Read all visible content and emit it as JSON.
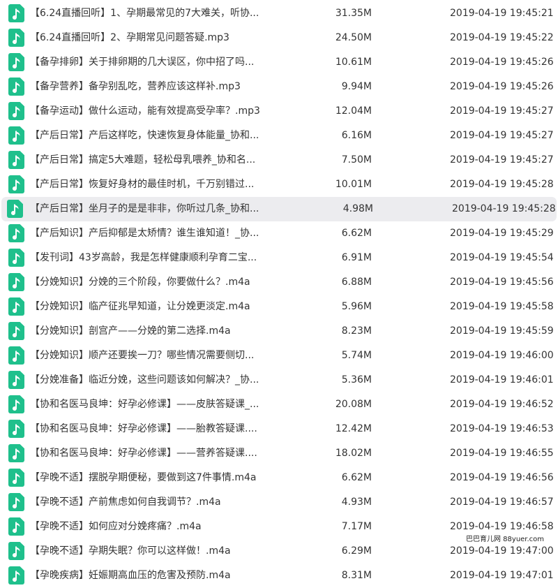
{
  "files": [
    {
      "name": "【6.24直播回听】1、孕期最常见的7大难关，听协...",
      "size": "31.35M",
      "date": "2019-04-19 19:45:21"
    },
    {
      "name": "【6.24直播回听】2、孕期常见问题答疑.mp3",
      "size": "24.50M",
      "date": "2019-04-19 19:45:22"
    },
    {
      "name": "【备孕排卵】关于排卵期的几大误区，你中招了吗...",
      "size": "10.61M",
      "date": "2019-04-19 19:45:26"
    },
    {
      "name": "【备孕营养】备孕别乱吃，营养应该这样补.mp3",
      "size": "9.94M",
      "date": "2019-04-19 19:45:26"
    },
    {
      "name": "【备孕运动】做什么运动，能有效提高受孕率？.mp3",
      "size": "12.04M",
      "date": "2019-04-19 19:45:27"
    },
    {
      "name": "【产后日常】产后这样吃，快速恢复身体能量_协和...",
      "size": "6.16M",
      "date": "2019-04-19 19:45:27"
    },
    {
      "name": "【产后日常】搞定5大难题，轻松母乳喂养_协和名...",
      "size": "7.50M",
      "date": "2019-04-19 19:45:27"
    },
    {
      "name": "【产后日常】恢复好身材的最佳时机，千万别错过...",
      "size": "10.01M",
      "date": "2019-04-19 19:45:28"
    },
    {
      "name": "【产后日常】坐月子的是是非非，你听过几条_协和...",
      "size": "4.98M",
      "date": "2019-04-19 19:45:28",
      "selected": true
    },
    {
      "name": "【产后知识】产后抑郁是太矫情？谁生谁知道！_协...",
      "size": "6.62M",
      "date": "2019-04-19 19:45:29"
    },
    {
      "name": "【发刊词】43岁高龄，我是怎样健康顺利孕育二宝...",
      "size": "6.91M",
      "date": "2019-04-19 19:45:54"
    },
    {
      "name": "【分娩知识】分娩的三个阶段，你要做什么？.m4a",
      "size": "6.88M",
      "date": "2019-04-19 19:45:56"
    },
    {
      "name": "【分娩知识】临产征兆早知道，让分娩更淡定.m4a",
      "size": "5.96M",
      "date": "2019-04-19 19:45:58"
    },
    {
      "name": "【分娩知识】剖宫产——分娩的第二选择.m4a",
      "size": "8.23M",
      "date": "2019-04-19 19:45:59"
    },
    {
      "name": "【分娩知识】顺产还要挨一刀？哪些情况需要侧切...",
      "size": "5.74M",
      "date": "2019-04-19 19:46:00"
    },
    {
      "name": "【分娩准备】临近分娩，这些问题该如何解决？_协...",
      "size": "5.36M",
      "date": "2019-04-19 19:46:01"
    },
    {
      "name": "【协和名医马良坤：好孕必修课】——皮肤答疑课_...",
      "size": "20.08M",
      "date": "2019-04-19 19:46:52"
    },
    {
      "name": "【协和名医马良坤：好孕必修课】——胎教答疑课....",
      "size": "12.42M",
      "date": "2019-04-19 19:46:53"
    },
    {
      "name": "【协和名医马良坤：好孕必修课】——营养答疑课....",
      "size": "18.02M",
      "date": "2019-04-19 19:46:55"
    },
    {
      "name": "【孕晚不适】摆脱孕期便秘，要做到这7件事情.m4a",
      "size": "6.62M",
      "date": "2019-04-19 19:46:56"
    },
    {
      "name": "【孕晚不适】产前焦虑如何自我调节？.m4a",
      "size": "4.93M",
      "date": "2019-04-19 19:46:57"
    },
    {
      "name": "【孕晚不适】如何应对分娩疼痛？.m4a",
      "size": "7.17M",
      "date": "2019-04-19 19:46:58"
    },
    {
      "name": "【孕晚不适】孕期失眠？你可以这样做！.m4a",
      "size": "6.29M",
      "date": "2019-04-19 19:47:00"
    },
    {
      "name": "【孕晚疾病】妊娠期高血压的危害及预防.m4a",
      "size": "8.31M",
      "date": "2019-04-19 19:47:01"
    }
  ],
  "watermark": "巴巴育儿网 88yuer.com",
  "colors": {
    "icon_green": "#1fc08c",
    "selected_row_bg": "#ececef",
    "text": "#333333"
  },
  "icon_name": "music-file-icon"
}
